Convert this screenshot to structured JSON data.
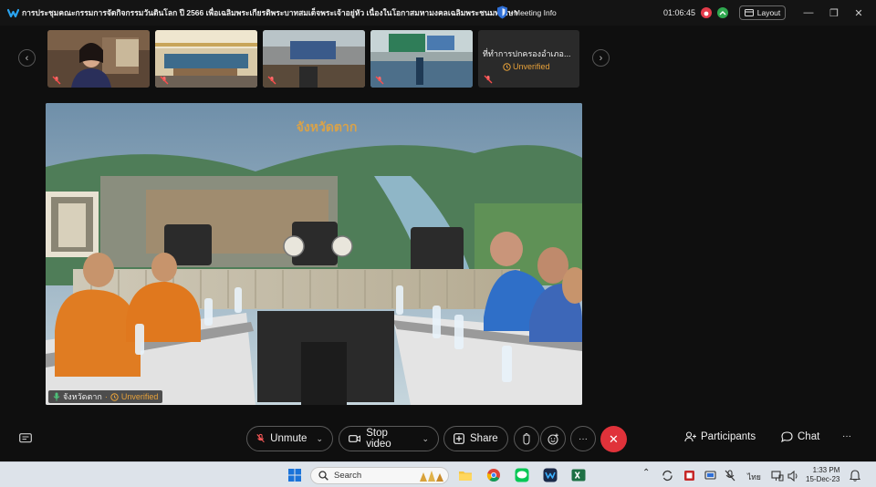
{
  "window": {
    "title": "การประชุมคณะกรรมการจัดกิจกรรมวันดินโลก ปี 2566 เพื่อเฉลิมพระเกียรติพระบาทสมเด็จพระเจ้าอยู่หัว  เนื่องในโอกาสมหามงคลเฉลิมพระชนมพรรษา",
    "meeting_info_label": "Meeting Info",
    "timer": "01:06:45",
    "layout_label": "Layout",
    "minimize_glyph": "—",
    "maximize_glyph": "❐",
    "close_glyph": "✕"
  },
  "thumbnails": {
    "prev_glyph": "‹",
    "next_glyph": "›",
    "text_tile": {
      "name": "ที่ทำการปกครองอำเภอ...",
      "status": "Unverified"
    }
  },
  "main_video": {
    "participant_name": "จังหวัดตาก",
    "separator": "·",
    "status": "Unverified",
    "backdrop_title": "จังหวัดตาก"
  },
  "toolbar": {
    "unmute_label": "Unmute",
    "stop_video_label": "Stop video",
    "share_label": "Share",
    "more_glyph": "···",
    "end_glyph": "✕",
    "participants_label": "Participants",
    "chat_label": "Chat",
    "overflow_glyph": "···"
  },
  "taskbar": {
    "search_placeholder": "Search",
    "language": "ไทย",
    "time": "1:33 PM",
    "date": "15-Dec-23"
  },
  "colors": {
    "accent_red": "#e0323a",
    "unverified_orange": "#e8a23a",
    "record_green": "#2fa84f",
    "record_red": "#e23b4a"
  }
}
